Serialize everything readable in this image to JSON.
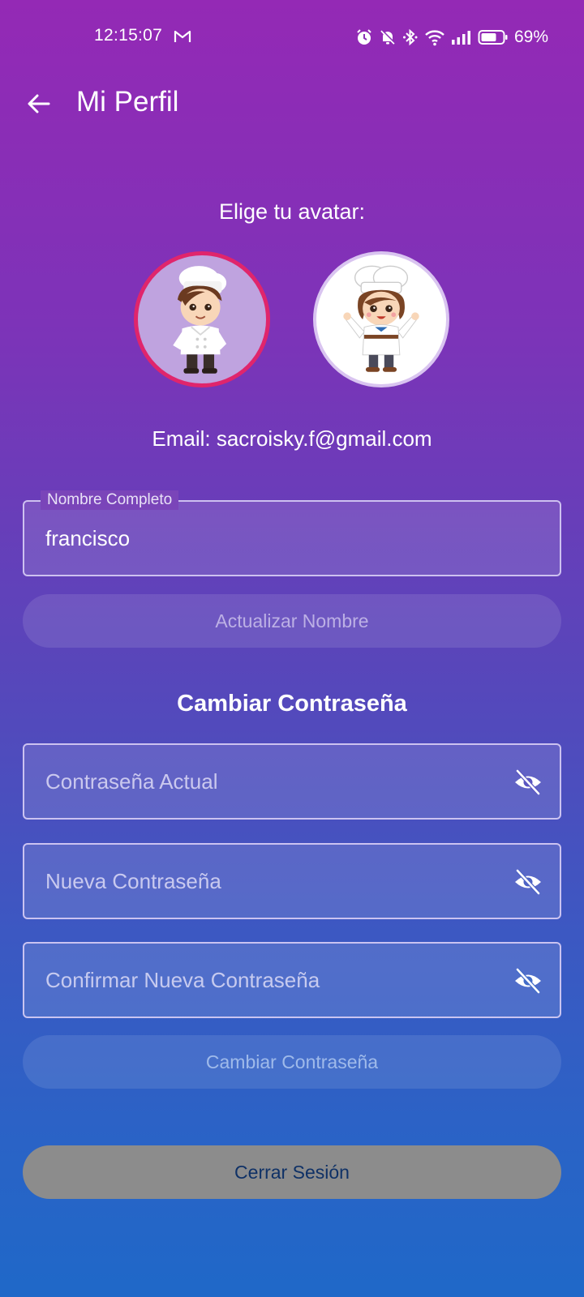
{
  "status_bar": {
    "time": "12:15:07",
    "battery_percent": "69%",
    "icons": [
      "gmail-icon",
      "alarm-icon",
      "bell-off-icon",
      "bluetooth-icon",
      "wifi-icon",
      "signal-icon",
      "battery-icon"
    ]
  },
  "app_bar": {
    "back_icon": "arrow-left-icon",
    "title": "Mi Perfil"
  },
  "avatar_section": {
    "heading": "Elige tu avatar:",
    "options": [
      {
        "name": "male-chef",
        "selected": true
      },
      {
        "name": "female-chef",
        "selected": false
      }
    ]
  },
  "email_text": "Email: sacroisky.f@gmail.com",
  "name_field": {
    "label": "Nombre Completo",
    "value": "francisco"
  },
  "update_name_button": "Actualizar Nombre",
  "password_section": {
    "title": "Cambiar Contraseña",
    "fields": [
      {
        "placeholder": "Contraseña Actual",
        "icon": "eye-off-icon"
      },
      {
        "placeholder": "Nueva Contraseña",
        "icon": "eye-off-icon"
      },
      {
        "placeholder": "Confirmar Nueva Contraseña",
        "icon": "eye-off-icon"
      }
    ],
    "submit_button": "Cambiar Contraseña"
  },
  "logout_button": "Cerrar Sesión",
  "colors": {
    "gradient_top": "#9429b5",
    "gradient_bottom": "#1f68c8",
    "selected_avatar_ring": "#e0256c",
    "logout_button_bg": "#8c8c8c",
    "logout_text": "#0f3166"
  }
}
